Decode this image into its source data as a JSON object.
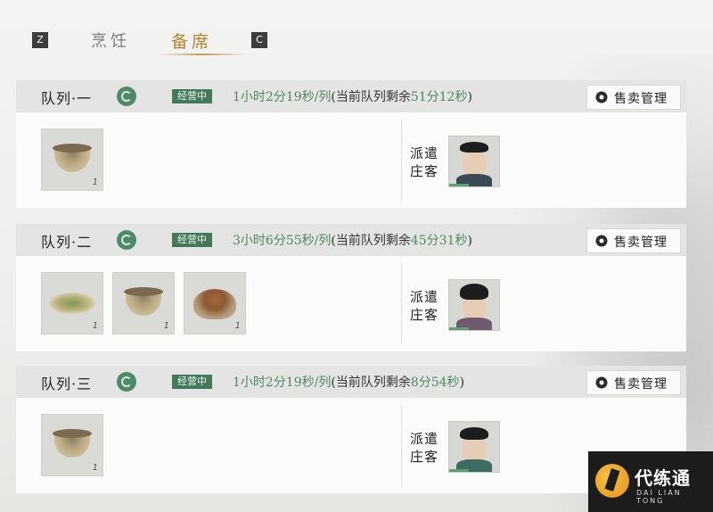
{
  "tabs": {
    "left_key": "Z",
    "right_key": "C",
    "items": [
      {
        "label": "烹饪",
        "active": false
      },
      {
        "label": "备席",
        "active": true
      }
    ]
  },
  "queues": [
    {
      "name": "队列·一",
      "badge": "经营中",
      "time_main": "1小时2分19秒/列",
      "time_paren_prefix": "(当前队列剩余",
      "time_remaining": "51分12秒",
      "time_paren_suffix": ")",
      "sell_label": "售卖管理",
      "dishes": [
        {
          "type": "bowl",
          "count": "1"
        }
      ],
      "dispatch_label_line1": "派遣",
      "dispatch_label_line2": "庄客",
      "worker": "male-official"
    },
    {
      "name": "队列·二",
      "badge": "经营中",
      "time_main": "3小时6分55秒/列",
      "time_paren_prefix": "(当前队列剩余",
      "time_remaining": "45分31秒",
      "time_paren_suffix": ")",
      "sell_label": "售卖管理",
      "dishes": [
        {
          "type": "plate",
          "count": "1"
        },
        {
          "type": "bowl",
          "count": "1"
        },
        {
          "type": "soup",
          "count": "1"
        }
      ],
      "dispatch_label_line1": "派遣",
      "dispatch_label_line2": "庄客",
      "worker": "female-noble"
    },
    {
      "name": "队列·三",
      "badge": "经营中",
      "time_main": "1小时2分19秒/列",
      "time_paren_prefix": "(当前队列剩余",
      "time_remaining": "8分54秒",
      "time_paren_suffix": ")",
      "sell_label": "售卖管理",
      "dishes": [
        {
          "type": "bowl",
          "count": "1"
        }
      ],
      "dispatch_label_line1": "派遣",
      "dispatch_label_line2": "庄客",
      "worker": "female-servant"
    }
  ],
  "watermark": {
    "title": "代练通",
    "subtitle": "DAI LIAN TONG"
  },
  "colors": {
    "accent_gold": "#b3852c",
    "status_green": "#3f7a5a",
    "time_green": "#4b8a63"
  }
}
